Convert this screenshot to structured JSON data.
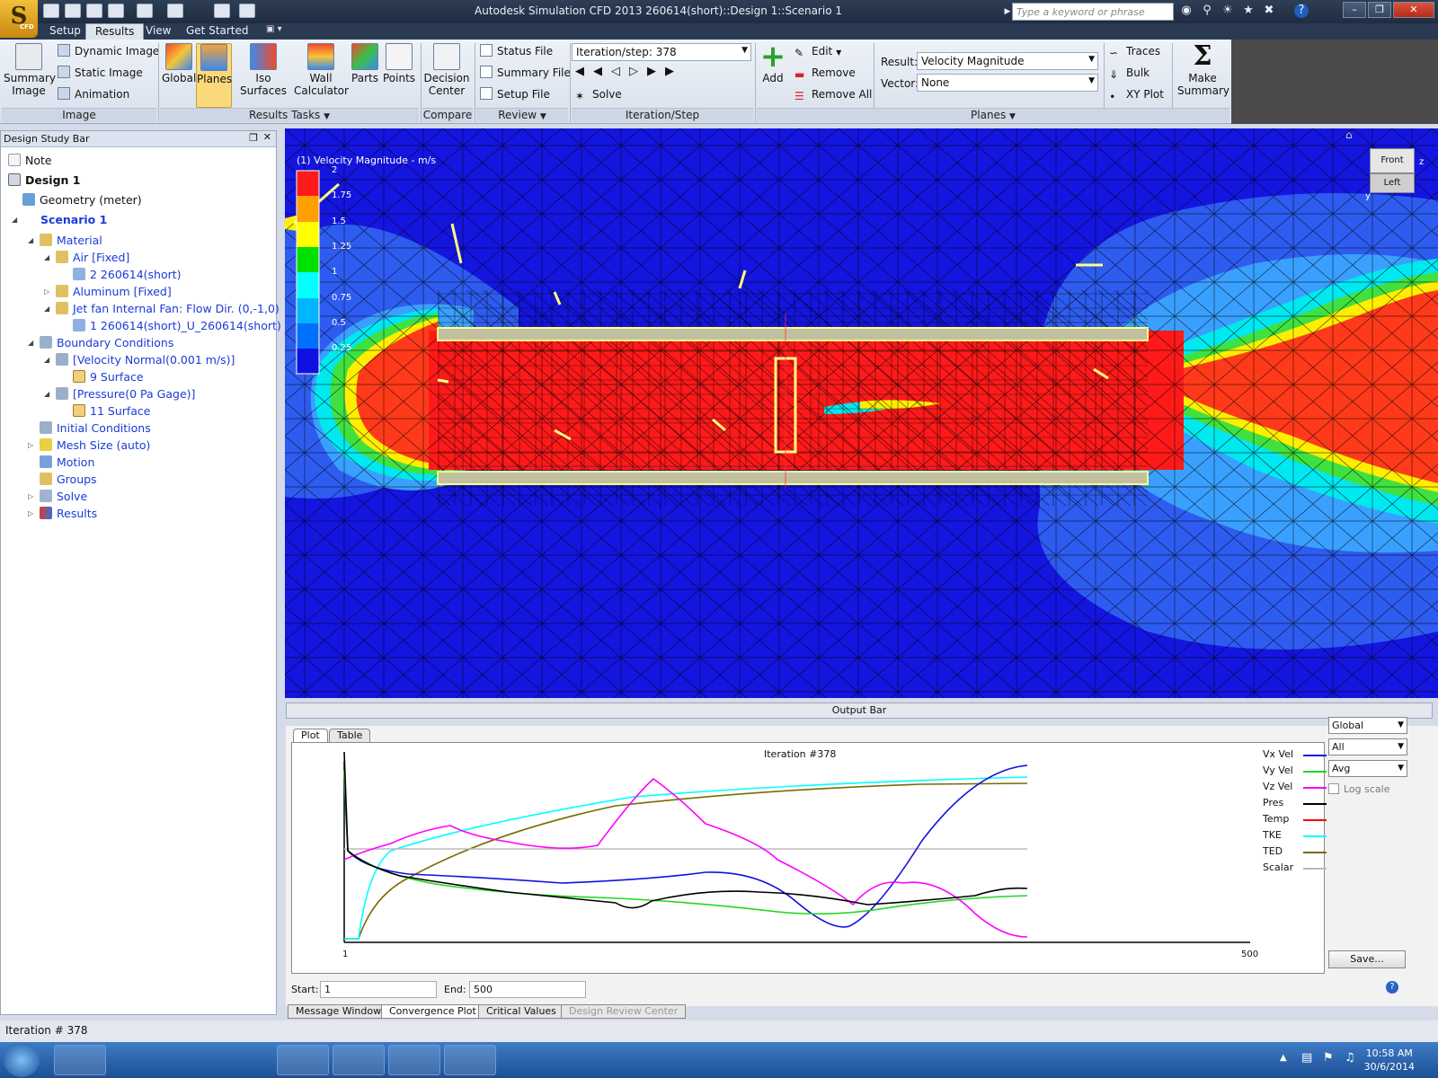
{
  "window": {
    "title": "Autodesk Simulation CFD 2013   260614(short)::Design 1::Scenario 1",
    "search_placeholder": "Type a keyword or phrase",
    "logo_text": "CFD"
  },
  "menu": {
    "tabs": [
      {
        "label": "Setup",
        "active": false
      },
      {
        "label": "Results",
        "active": true
      },
      {
        "label": "View",
        "active": false
      },
      {
        "label": "Get Started",
        "active": false
      }
    ]
  },
  "ribbon": {
    "image": {
      "summary_image": "Summary Image",
      "dynamic_image": "Dynamic Image",
      "static_image": "Static Image",
      "animation": "Animation",
      "group": "Image"
    },
    "results_tasks": {
      "global": "Global",
      "planes": "Planes",
      "iso_surfaces": "Iso Surfaces",
      "wall_calculator": "Wall Calculator",
      "parts": "Parts",
      "points": "Points",
      "group": "Results Tasks"
    },
    "compare": {
      "decision_center": "Decision Center",
      "group": "Compare"
    },
    "review": {
      "status_file": "Status File",
      "summary_file": "Summary File",
      "setup_file": "Setup File",
      "group": "Review"
    },
    "iteration": {
      "dropdown": "Iteration/step: 378",
      "solve": "Solve",
      "group": "Iteration/Step"
    },
    "planes": {
      "add": "Add",
      "edit": "Edit",
      "remove": "Remove",
      "remove_all": "Remove All",
      "result_label": "Result:",
      "result_value": "Velocity Magnitude",
      "vector_label": "Vector:",
      "vector_value": "None",
      "traces": "Traces",
      "bulk": "Bulk",
      "xy_plot": "XY Plot",
      "make_summary": "Make Summary",
      "group": "Planes"
    }
  },
  "design_study_bar": {
    "title": "Design Study Bar",
    "items": [
      {
        "label": "Note"
      },
      {
        "label": "Design 1"
      },
      {
        "label": "Geometry (meter)"
      },
      {
        "label": "Scenario 1"
      },
      {
        "label": "Material"
      },
      {
        "label": "Air [Fixed]"
      },
      {
        "label": "2 260614(short)"
      },
      {
        "label": "Aluminum [Fixed]"
      },
      {
        "label": "Jet fan Internal Fan: Flow Dir. (0,-1,0)"
      },
      {
        "label": "1 260614(short)_U_260614(short)"
      },
      {
        "label": "Boundary Conditions"
      },
      {
        "label": "[Velocity Normal(0.001 m/s)]"
      },
      {
        "label": "9 Surface"
      },
      {
        "label": "[Pressure(0 Pa Gage)]"
      },
      {
        "label": "11 Surface"
      },
      {
        "label": "Initial Conditions"
      },
      {
        "label": "Mesh Size (auto)"
      },
      {
        "label": "Motion"
      },
      {
        "label": "Groups"
      },
      {
        "label": "Solve"
      },
      {
        "label": "Results"
      }
    ]
  },
  "viewport": {
    "legend_title": "(1) Velocity Magnitude - m/s",
    "legend_ticks": [
      "2",
      "1.75",
      "1.5",
      "1.25",
      "1",
      "0.75",
      "0.5",
      "0.25"
    ],
    "legend_colors": [
      "#ff1a1a",
      "#ff9f00",
      "#ffff00",
      "#00e000",
      "#00ffff",
      "#00b4ff",
      "#0070ff",
      "#1010e0"
    ],
    "nav_cube": {
      "front": "Front",
      "left": "Left",
      "z": "z",
      "y": "y"
    }
  },
  "output_bar": {
    "title": "Output Bar",
    "tabs": [
      {
        "label": "Plot",
        "active": true
      },
      {
        "label": "Table",
        "active": false
      }
    ],
    "plot_title": "Iteration #378",
    "x_start_label": "1",
    "x_end_label": "500",
    "series_colors": {
      "vx": "#1010e0",
      "vy": "#1ed81e",
      "vz": "#ff00ff",
      "pres": "#000000",
      "temp": "#ff0000",
      "tke": "#00ffff",
      "ted": "#7a6a00",
      "scalar": "#bbbbbb"
    },
    "legend": [
      {
        "label": "Vx Vel",
        "color": "#1010e0"
      },
      {
        "label": "Vy Vel",
        "color": "#1ed81e"
      },
      {
        "label": "Vz Vel",
        "color": "#ff00ff"
      },
      {
        "label": "Pres",
        "color": "#000000"
      },
      {
        "label": "Temp",
        "color": "#ff0000"
      },
      {
        "label": "TKE",
        "color": "#00ffff"
      },
      {
        "label": "TED",
        "color": "#7a6a00"
      },
      {
        "label": "Scalar",
        "color": "#bbbbbb"
      }
    ],
    "dropdowns": [
      "Global",
      "All",
      "Avg"
    ],
    "log_scale": "Log scale",
    "save": "Save...",
    "start_label": "Start:",
    "start_value": "1",
    "end_label": "End:",
    "end_value": "500",
    "bottom_tabs": [
      {
        "label": "Message Window",
        "active": false
      },
      {
        "label": "Convergence Plot",
        "active": true
      },
      {
        "label": "Critical Values",
        "active": false
      },
      {
        "label": "Design Review Center",
        "active": false
      }
    ]
  },
  "status": {
    "text": "Iteration # 378"
  },
  "taskbar": {
    "time": "10:58 AM",
    "date": "30/6/2014"
  }
}
